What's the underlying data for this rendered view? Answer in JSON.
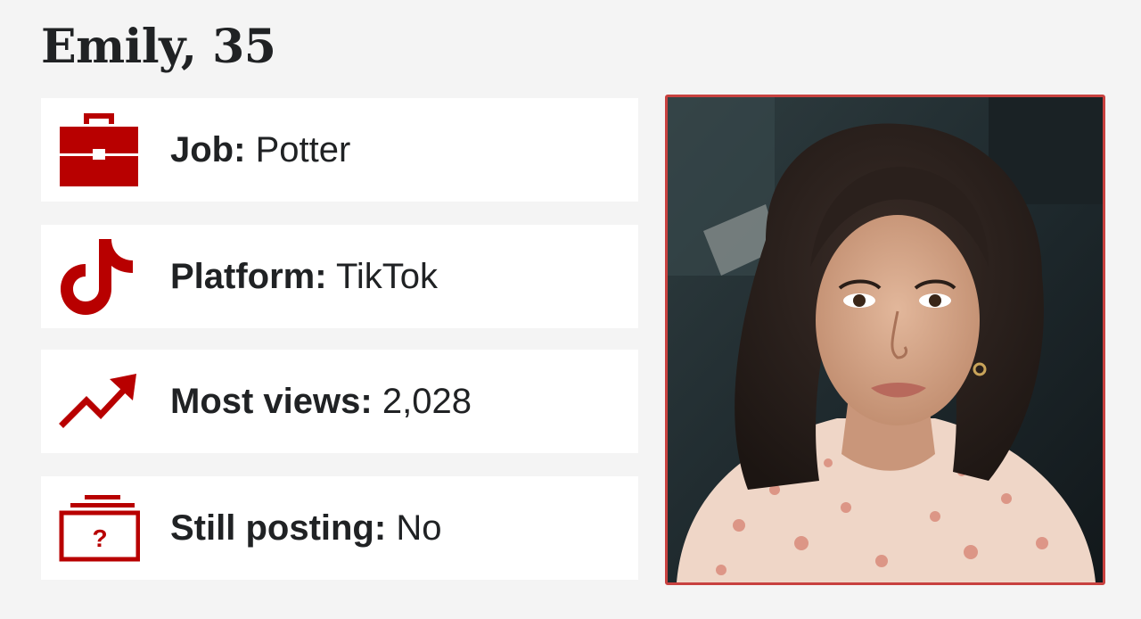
{
  "profile": {
    "title": "Emily, 35"
  },
  "rows": [
    {
      "icon": "briefcase-icon",
      "label": "Job:",
      "value": "Potter"
    },
    {
      "icon": "tiktok-icon",
      "label": "Platform:",
      "value": "TikTok"
    },
    {
      "icon": "trending-up-icon",
      "label": "Most views:",
      "value": "2,028"
    },
    {
      "icon": "question-box-icon",
      "label": "Still posting:",
      "value": "No"
    }
  ],
  "photo": {
    "subject": "portrait of Emily"
  },
  "colors": {
    "accent": "#b80000",
    "frame": "#c8413f",
    "background": "#f4f4f4",
    "card": "#ffffff",
    "text": "#202224"
  }
}
